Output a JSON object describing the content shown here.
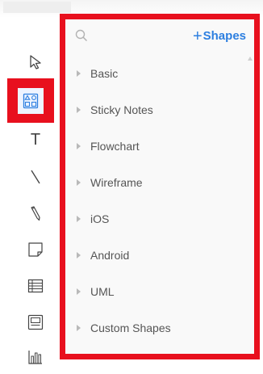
{
  "header": {
    "search_icon": "search-icon",
    "plus_symbol": "+",
    "shapes_label": "Shapes",
    "accent_color": "#2d7fe0"
  },
  "toolbar": {
    "tools": [
      {
        "name": "select",
        "icon": "cursor-arrow-icon"
      },
      {
        "name": "shapes",
        "icon": "shapes-grid-icon",
        "active": true
      },
      {
        "name": "text",
        "icon": "text-tool-icon",
        "glyph": "T"
      },
      {
        "name": "line",
        "icon": "line-tool-icon"
      },
      {
        "name": "pencil",
        "icon": "pencil-icon"
      },
      {
        "name": "sticky-note",
        "icon": "sticky-note-icon"
      },
      {
        "name": "table",
        "icon": "table-icon"
      },
      {
        "name": "frame",
        "icon": "frame-icon"
      },
      {
        "name": "chart",
        "icon": "chart-icon"
      }
    ]
  },
  "library": {
    "categories": [
      {
        "label": "Basic"
      },
      {
        "label": "Sticky Notes"
      },
      {
        "label": "Flowchart"
      },
      {
        "label": "Wireframe"
      },
      {
        "label": "iOS"
      },
      {
        "label": "Android"
      },
      {
        "label": "UML"
      },
      {
        "label": "Custom Shapes"
      }
    ]
  },
  "colors": {
    "highlight": "#e8101e",
    "panel_bg": "#f9f9f9",
    "active_tool_bg": "#eef4ff"
  }
}
